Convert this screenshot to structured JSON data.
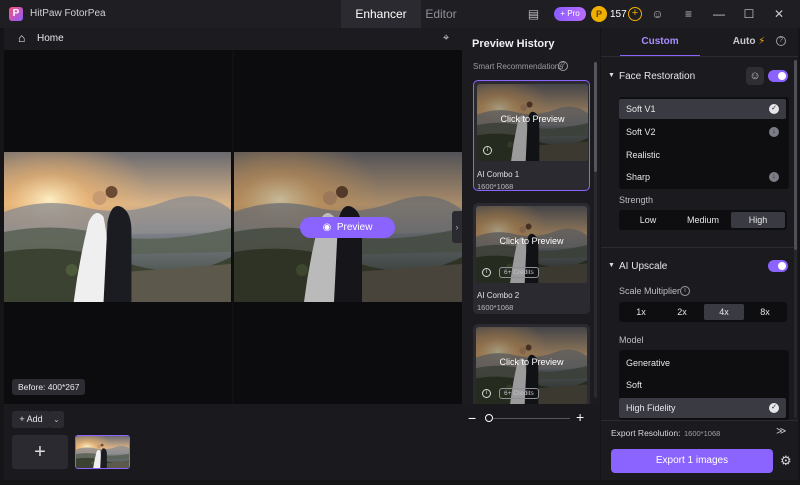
{
  "app": {
    "name": "HitPaw FotorPea",
    "logo_letter": "P"
  },
  "tabs": [
    {
      "label": "Enhancer",
      "active": true
    },
    {
      "label": "Editor",
      "active": false
    }
  ],
  "titlebar": {
    "pro_label": "+ Pro",
    "coin_count": "157"
  },
  "toolbar": {
    "home_label": "Home"
  },
  "preview": {
    "button_label": "Preview",
    "before_label": "Before: 400*267"
  },
  "bottom": {
    "add_label": "Add"
  },
  "history": {
    "title": "Preview History",
    "smart_label": "Smart Recommendations",
    "cards": [
      {
        "caption": "Click to Preview",
        "name": "AI Combo 1",
        "resolution": "1600*1068",
        "credits": null,
        "selected": true
      },
      {
        "caption": "Click to Preview",
        "name": "AI Combo 2",
        "resolution": "1600*1068",
        "credits": "6+ Credits",
        "selected": false
      },
      {
        "caption": "Click to Preview",
        "name": "",
        "resolution": "",
        "credits": "6+ Credits",
        "selected": false
      }
    ]
  },
  "settings": {
    "tab_custom": "Custom",
    "tab_auto": "Auto",
    "face": {
      "title": "Face Restoration",
      "enabled": true,
      "models": [
        {
          "label": "Soft V1",
          "state": "selected"
        },
        {
          "label": "Soft V2",
          "state": "download"
        },
        {
          "label": "Realistic",
          "state": "none"
        },
        {
          "label": "Sharp",
          "state": "download"
        }
      ],
      "strength_label": "Strength",
      "strength_options": [
        "Low",
        "Medium",
        "High"
      ],
      "strength_selected": "High"
    },
    "upscale": {
      "title": "AI Upscale",
      "enabled": true,
      "scale_label": "Scale Multiplier",
      "scale_options": [
        "1x",
        "2x",
        "4x",
        "8x"
      ],
      "scale_selected": "4x",
      "model_label": "Model",
      "models": [
        {
          "label": "Generative",
          "state": "none"
        },
        {
          "label": "Soft",
          "state": "none"
        },
        {
          "label": "High Fidelity",
          "state": "selected"
        }
      ]
    },
    "export_label": "Export Resolution:",
    "export_resolution": "1600*1068",
    "export_button": "Export 1 images"
  },
  "colors": {
    "accent": "#8b63ff",
    "coin": "#f0b000"
  }
}
